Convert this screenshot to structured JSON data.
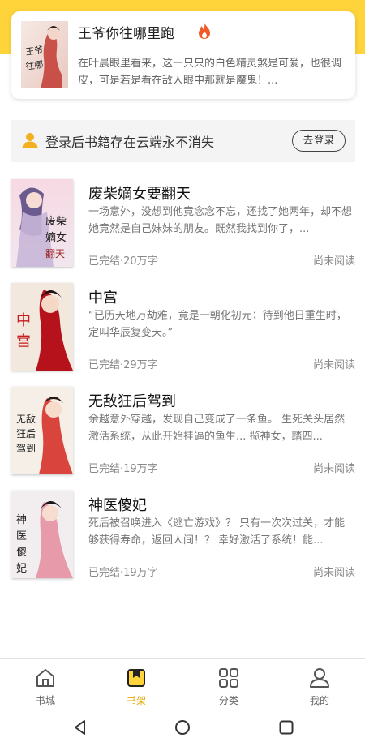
{
  "featured": {
    "title": "王爷你往哪里跑",
    "description": "在叶晨眼里看来，这一只只的白色精灵煞是可爱，也很调皮，可是若是看在敌人眼中那就是魔鬼！...",
    "cover_text": "王爷你往哪里跑",
    "icon": "fire-icon"
  },
  "login_bar": {
    "text": "登录后书籍存在云端永不消失",
    "button": "去登录",
    "icon": "person-icon"
  },
  "books": [
    {
      "title": "废柴嫡女要翻天",
      "description": "一场意外，没想到他竟念念不忘，还找了她两年，却不想她竟然是自己妹妹的朋友。既然我找到你了，...",
      "meta": "已完结·20万字",
      "status": "尚未阅读"
    },
    {
      "title": "中宫",
      "description": "“已历天地万劫难，竟是一朝化初元；待到他日重生时，定叫华辰复变天。”",
      "meta": "已完结·29万字",
      "status": "尚未阅读"
    },
    {
      "title": "无敌狂后驾到",
      "description": "余越意外穿越，发现自己变成了一条鱼。 生死关头居然激活系统，从此开始挂逼的鱼生... 揽神女，踏四...",
      "meta": "已完结·19万字",
      "status": "尚未阅读"
    },
    {
      "title": "神医傻妃",
      "description": "死后被召唤进入《逃亡游戏》？ 只有一次次过关，才能够获得寿命，返回人间！？ 幸好激活了系统！能...",
      "meta": "已完结·19万字",
      "status": "尚未阅读"
    }
  ],
  "tabs": [
    {
      "label": "书城",
      "icon": "bookstore-icon"
    },
    {
      "label": "书架",
      "icon": "bookshelf-icon",
      "active": true
    },
    {
      "label": "分类",
      "icon": "category-grid-icon"
    },
    {
      "label": "我的",
      "icon": "profile-icon"
    }
  ],
  "colors": {
    "accent": "#ffd43b",
    "active_tab": "#e5a800",
    "login_bar_bg": "#f4f4f4"
  }
}
